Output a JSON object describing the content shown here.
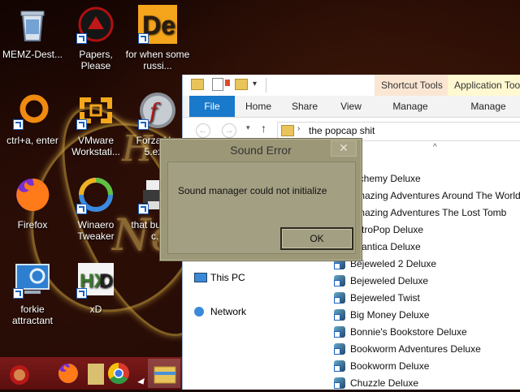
{
  "desktop": {
    "icons": [
      {
        "label": "MEMZ-Dest...",
        "icon": "recycle-bin-icon"
      },
      {
        "label": "Papers, Please",
        "icon": "papers-please-icon"
      },
      {
        "label": "for when some russi...",
        "icon": "de-app-icon"
      },
      {
        "label": "ctrl+a, enter",
        "icon": "ring-icon"
      },
      {
        "label": "VMware Workstati...",
        "icon": "vmware-icon"
      },
      {
        "label": "Forza H... 5.ex...",
        "icon": "flash-icon"
      },
      {
        "label": "Firefox",
        "icon": "firefox-icon"
      },
      {
        "label": "Winaero Tweaker",
        "icon": "winaero-icon"
      },
      {
        "label": "that but... its c...",
        "icon": "printer-icon"
      },
      {
        "label": "forkie attractant",
        "icon": "control-panel-icon"
      },
      {
        "label": "xD",
        "icon": "hxd-icon"
      }
    ]
  },
  "explorer": {
    "context_tabs": [
      "Shortcut Tools",
      "Application Too"
    ],
    "tabs": [
      "File",
      "Home",
      "Share",
      "View",
      "Manage",
      "Manage"
    ],
    "address": "the popcap shit",
    "nav_pane": [
      "This PC",
      "Network"
    ],
    "files": [
      "Alchemy Deluxe",
      "Amazing Adventures Around The World",
      "Amazing Adventures The Lost Tomb",
      "AstroPop Deluxe",
      "Atlantica Deluxe",
      "Bejeweled 2 Deluxe",
      "Bejeweled Deluxe",
      "Bejeweled Twist",
      "Big Money Deluxe",
      "Bonnie's Bookstore Deluxe",
      "Bookworm Adventures Deluxe",
      "Bookworm Deluxe",
      "Chuzzle Deluxe"
    ]
  },
  "dialog": {
    "title": "Sound Error",
    "message": "Sound manager could not initialize",
    "ok_label": "OK",
    "close_glyph": "✕"
  },
  "colors": {
    "dialog_bg": "#9c9777",
    "taskbar": "#6b1414",
    "ribbon_file": "#1979ca"
  }
}
